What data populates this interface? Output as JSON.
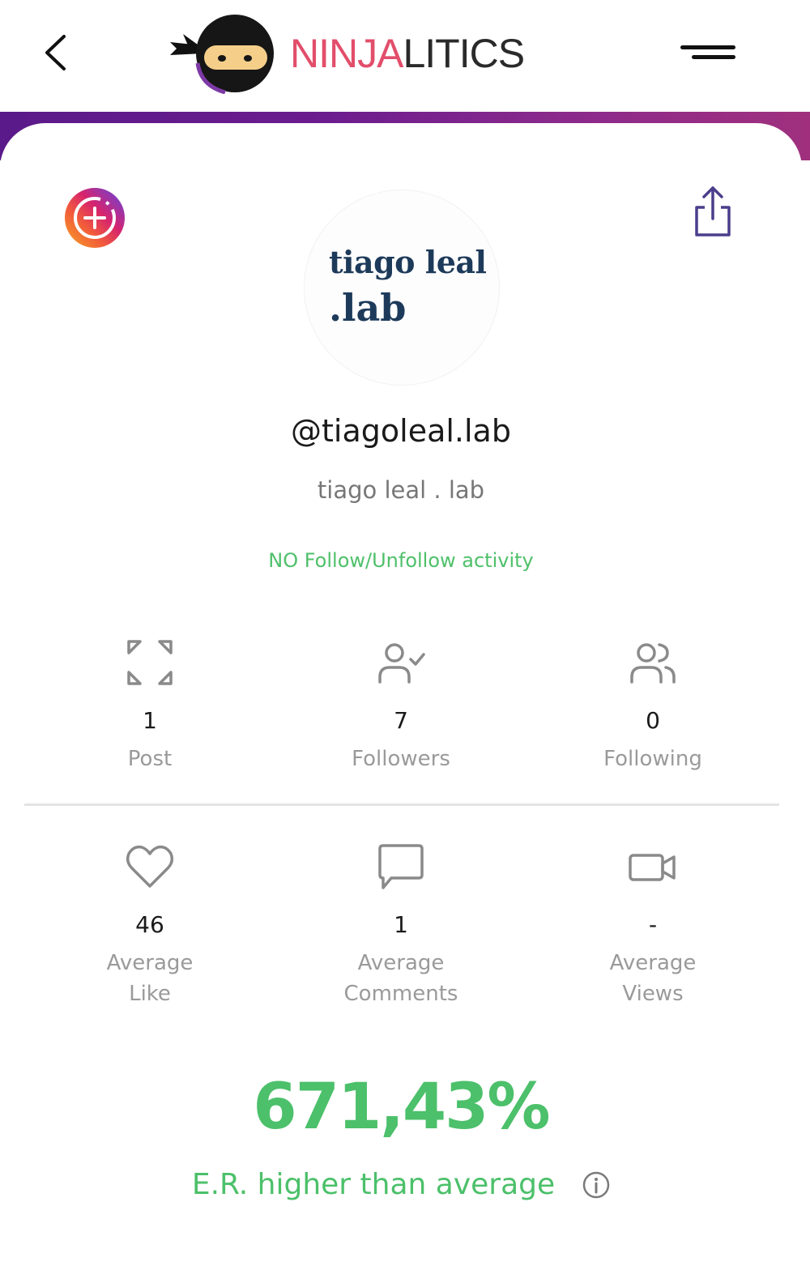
{
  "header": {
    "logo_part1": "NINJA",
    "logo_part2": "LITICS"
  },
  "profile": {
    "avatar_line1": "tiago leal",
    "avatar_line2": ".lab",
    "username": "@tiagoleal.lab",
    "full_name": "tiago leal . lab",
    "activity_status": "NO Follow/Unfollow activity"
  },
  "stats_row1": [
    {
      "icon": "expand-icon",
      "value": "1",
      "label": "Post"
    },
    {
      "icon": "user-check-icon",
      "value": "7",
      "label": "Followers"
    },
    {
      "icon": "users-icon",
      "value": "0",
      "label": "Following"
    }
  ],
  "stats_row2": [
    {
      "icon": "heart-icon",
      "value": "46",
      "label_line1": "Average",
      "label_line2": "Like"
    },
    {
      "icon": "comment-icon",
      "value": "1",
      "label_line1": "Average",
      "label_line2": "Comments"
    },
    {
      "icon": "video-icon",
      "value": "-",
      "label_line1": "Average",
      "label_line2": "Views"
    }
  ],
  "engagement": {
    "value": "671,43%",
    "label": "E.R. higher than average"
  },
  "colors": {
    "accent_green": "#4cc06a",
    "logo_pink": "#e24e6b",
    "band_purple": "#5a1a8a",
    "avatar_text": "#1d3a5a"
  }
}
